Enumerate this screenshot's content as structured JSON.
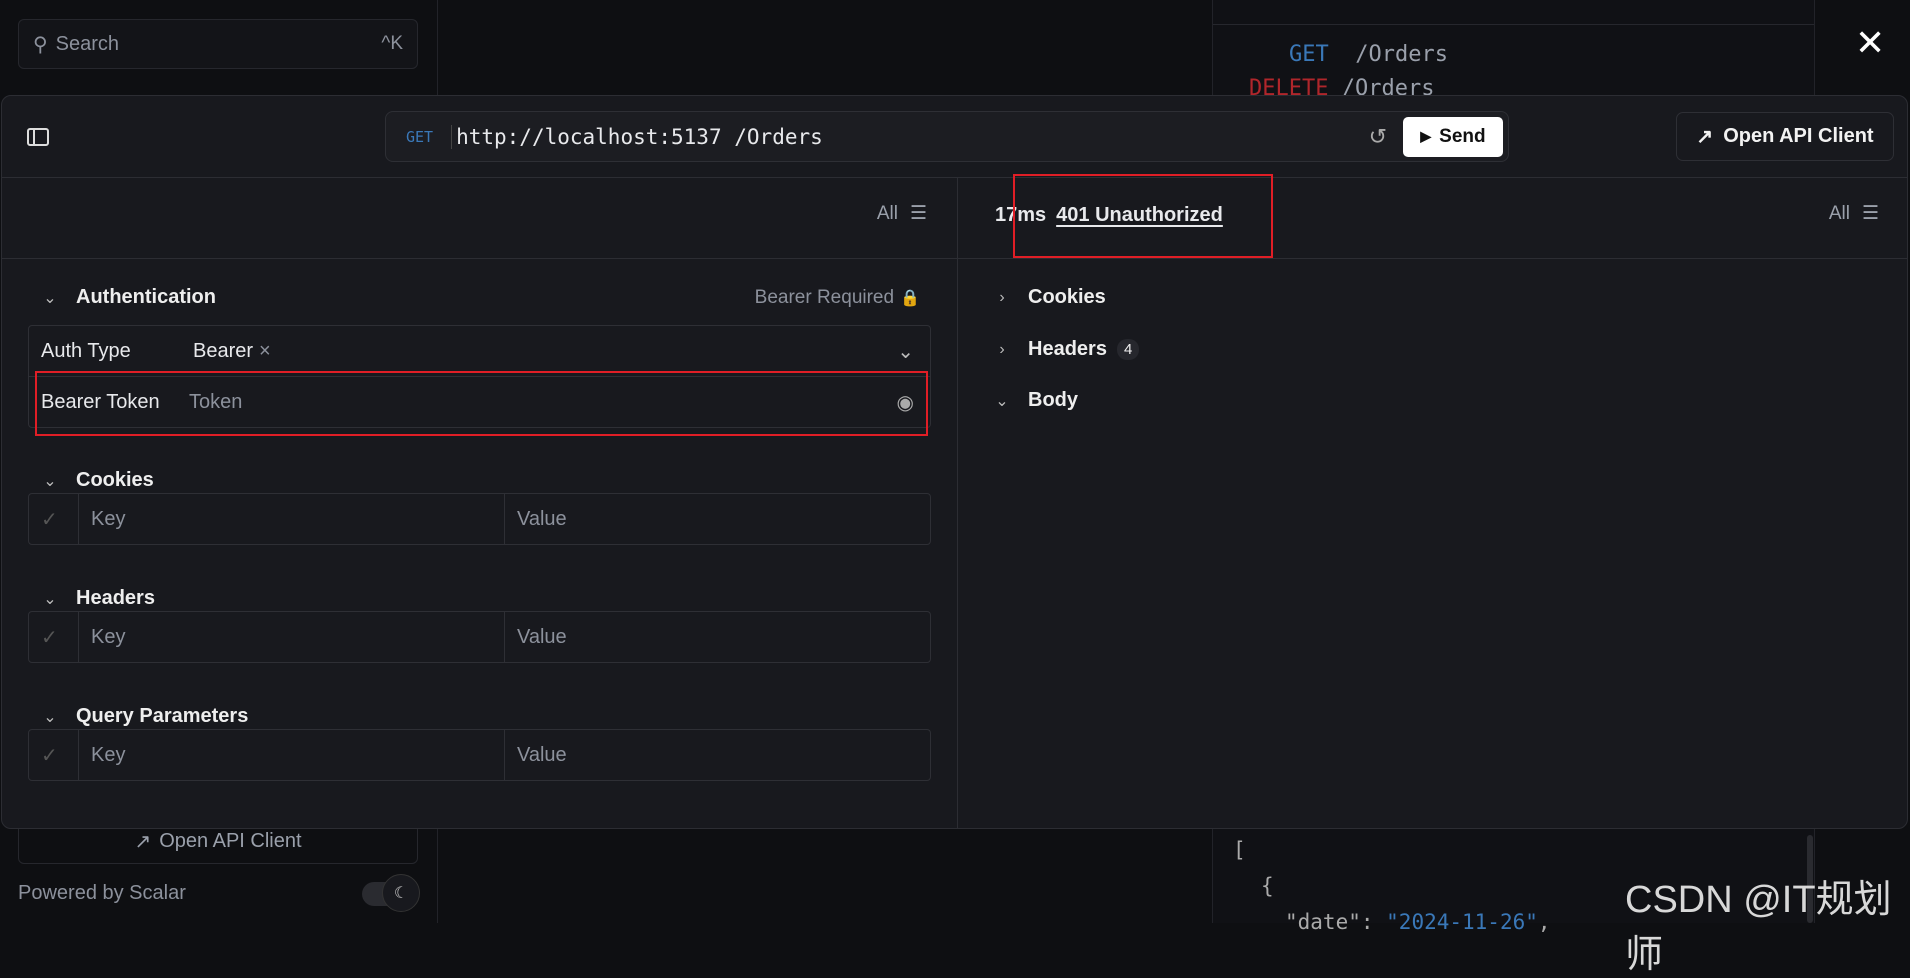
{
  "background": {
    "search": {
      "placeholder": "Search",
      "shortcut": "^K"
    },
    "endpoints": [
      {
        "method": "GET",
        "path": "/Orders"
      },
      {
        "method": "DELETE",
        "path": "/Orders"
      }
    ],
    "open_client": "Open API Client",
    "powered_by": "Powered by Scalar",
    "code": [
      "[",
      "{",
      "\"date\"",
      ": ",
      "\"2024-11-26\"",
      ","
    ]
  },
  "modal": {
    "method": "GET",
    "url": "http://localhost:5137",
    "path": "/Orders",
    "send": "Send",
    "open_client": "Open API Client",
    "filter_left": "All",
    "filter_right": "All",
    "response": {
      "time": "17ms",
      "status": "401 Unauthorized"
    },
    "auth": {
      "title": "Authentication",
      "required": "Bearer Required",
      "type_label": "Auth Type",
      "type_value": "Bearer",
      "token_label": "Bearer Token",
      "token_placeholder": "Token"
    },
    "sections": [
      {
        "title": "Cookies",
        "key": "Key",
        "value": "Value"
      },
      {
        "title": "Headers",
        "key": "Key",
        "value": "Value"
      },
      {
        "title": "Query Parameters",
        "key": "Key",
        "value": "Value"
      }
    ],
    "response_sections": [
      {
        "title": "Cookies"
      },
      {
        "title": "Headers",
        "count": "4"
      },
      {
        "title": "Body"
      }
    ]
  },
  "watermark": "CSDN @IT规划师",
  "colors": {
    "get": "#3a78b8",
    "delete": "#b0262b",
    "highlight": "#e01e26"
  }
}
